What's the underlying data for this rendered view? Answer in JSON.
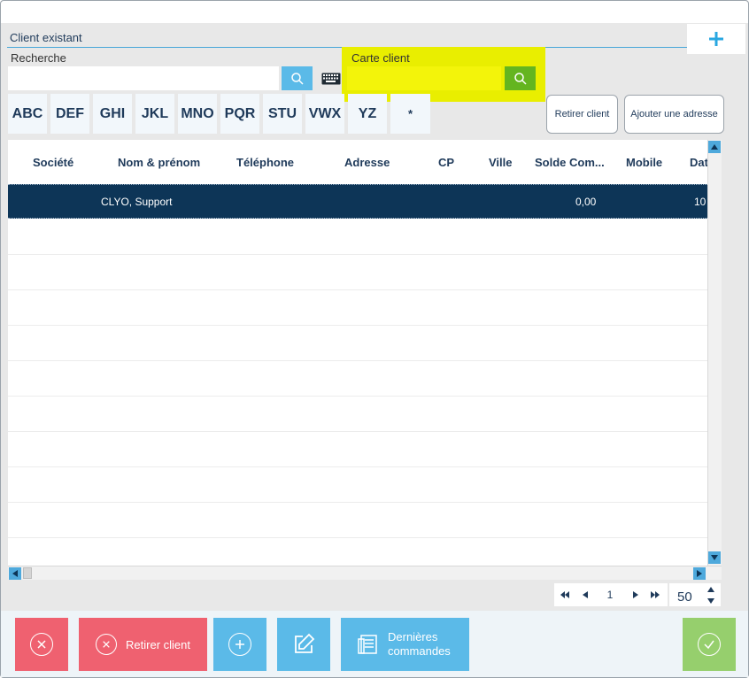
{
  "section": {
    "title": "Client existant"
  },
  "search": {
    "label": "Recherche",
    "value": "",
    "placeholder": ""
  },
  "card": {
    "label": "Carte client",
    "value": ""
  },
  "alphabet": [
    "ABC",
    "DEF",
    "GHI",
    "JKL",
    "MNO",
    "PQR",
    "STU",
    "VWX",
    "YZ",
    "*"
  ],
  "actions": {
    "remove_client": "Retirer client",
    "add_address": "Ajouter une adresse"
  },
  "table": {
    "columns": [
      "Société",
      "Nom & prénom",
      "Téléphone",
      "Adresse",
      "CP",
      "Ville",
      "Solde Com...",
      "Mobile",
      "Dat"
    ],
    "rows": [
      {
        "societe": "",
        "nom": "CLYO, Support",
        "telephone": "",
        "adresse": "",
        "cp": "",
        "ville": "",
        "solde": "0,00",
        "mobile": "",
        "date": "10"
      }
    ]
  },
  "pager": {
    "page": "1",
    "page_size": "50"
  },
  "footer": {
    "remove_client": "Retirer client",
    "last_orders_line1": "Dernières",
    "last_orders_line2": "commandes"
  },
  "colors": {
    "accent": "#5bbae8",
    "danger": "#ef6170",
    "success": "#96cf6d",
    "highlight": "#e9ee00",
    "selected_row": "#0d3557"
  },
  "icons": [
    "plus-icon",
    "search-icon",
    "keyboard-icon",
    "close-circle-icon",
    "add-circle-icon",
    "edit-icon",
    "orders-icon",
    "check-circle-icon"
  ]
}
